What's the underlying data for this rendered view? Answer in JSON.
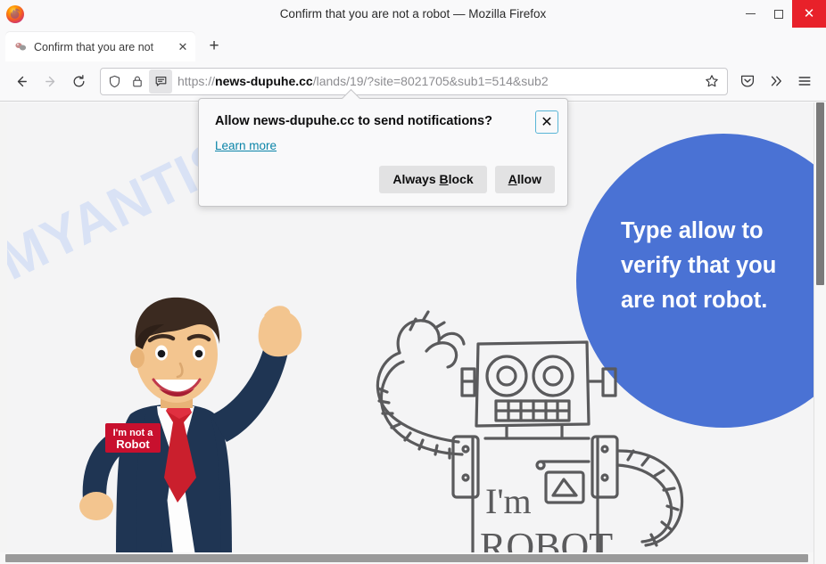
{
  "window": {
    "title": "Confirm that you are not a robot — Mozilla Firefox",
    "minimize_label": "–",
    "maximize_label": "□",
    "close_label": "✕",
    "logo_icon": "firefox-logo"
  },
  "tabs": {
    "active_tab_title": "Confirm that you are not",
    "tab_close_label": "✕",
    "new_tab_label": "+"
  },
  "toolbar": {
    "back_icon": "back-arrow-icon",
    "forward_icon": "forward-arrow-icon",
    "reload_icon": "reload-icon",
    "shield_icon": "shield-icon",
    "lock_icon": "padlock-icon",
    "permission_icon": "notification-permission-icon",
    "bookmark_icon": "star-outline-icon",
    "pocket_icon": "pocket-icon",
    "overflow_label": "»",
    "menu_icon": "hamburger-menu-icon"
  },
  "url": {
    "scheme": "https://",
    "domain": "news-dupuhe.cc",
    "path": "/lands/19/?site=8021705&sub1=514&sub2"
  },
  "notification_dialog": {
    "title": "Allow news-dupuhe.cc to send notifications?",
    "learn_more": "Learn more",
    "close_label": "✕",
    "always_block": {
      "pre": "Always ",
      "accesskey": "B",
      "post": "lock"
    },
    "allow": {
      "accesskey": "A",
      "post": "llow"
    }
  },
  "page": {
    "watermark": "MYANTISPYWARE.COM",
    "headline_lines": [
      "Type allow to",
      "verify that you",
      "are not robot."
    ],
    "man_badge_line1": "I'm not a",
    "man_badge_line2": "Robot",
    "robot_body_line1": "I'm",
    "robot_body_line2": "ROBOT",
    "accent_blue": "#4a72d4",
    "badge_red": "#c8102e",
    "suit_navy": "#1f3553",
    "skin": "#f3c58f"
  }
}
